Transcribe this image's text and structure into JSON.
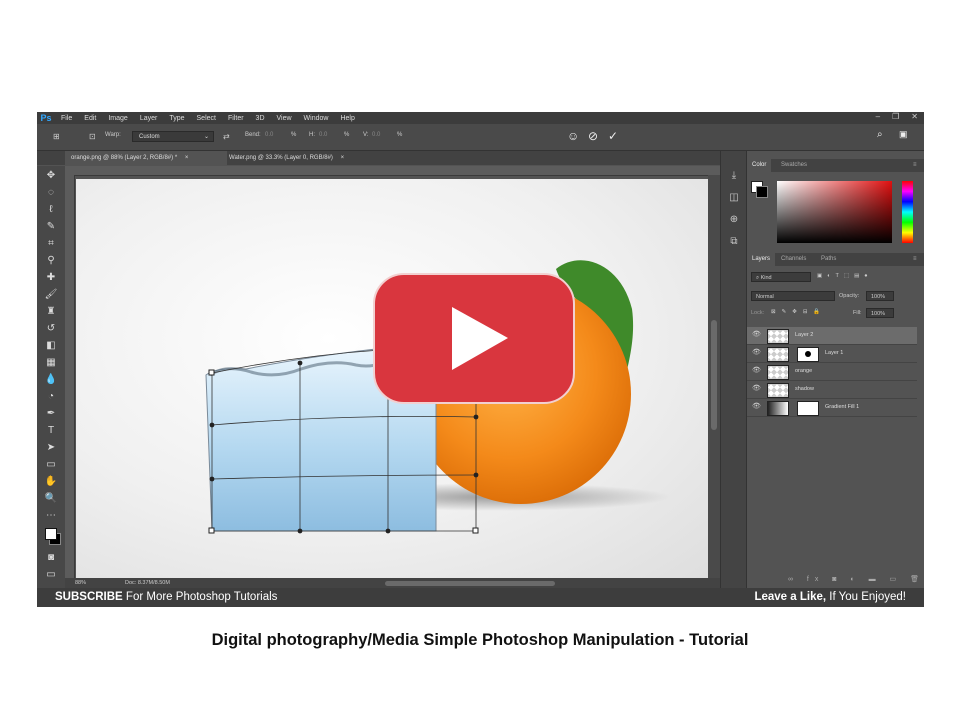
{
  "menu": [
    "File",
    "Edit",
    "Image",
    "Layer",
    "Type",
    "Select",
    "Filter",
    "3D",
    "View",
    "Window",
    "Help"
  ],
  "app_logo": "Ps",
  "options": {
    "warp_label": "Warp:",
    "warp_value": "Custom",
    "bend_label": "Bend:",
    "bend_value": "0.0",
    "bend_unit": "%",
    "h_label": "H:",
    "h_value": "0.0",
    "h_unit": "%",
    "v_label": "V:",
    "v_value": "0.0",
    "v_unit": "%"
  },
  "tabs": [
    {
      "label": "orange.png @ 88% (Layer 2, RGB/8#) *"
    },
    {
      "label": "Water.png @ 33.3% (Layer 0, RGB/8#)"
    }
  ],
  "tab_close": "×",
  "status": {
    "zoom": "88%",
    "doc": "Doc: 8.37M/8.50M"
  },
  "panels": {
    "color_tab": "Color",
    "swatches_tab": "Swatches",
    "layers_tab": "Layers",
    "channels_tab": "Channels",
    "paths_tab": "Paths",
    "kind_placeholder": "Kind",
    "blend_mode": "Normal",
    "opacity_label": "Opacity:",
    "opacity_value": "100%",
    "lock_label": "Lock:",
    "fill_label": "Fill:",
    "fill_value": "100%"
  },
  "layers": [
    {
      "name": "Layer 2",
      "selected": true
    },
    {
      "name": "Layer 1",
      "selected": false
    },
    {
      "name": "orange",
      "selected": false
    },
    {
      "name": "shadow",
      "selected": false
    },
    {
      "name": "Gradient Fill 1",
      "selected": false
    }
  ],
  "banner": {
    "subscribe": "SUBSCRIBE",
    "subscribe_rest": " For More Photoshop Tutorials",
    "like": "Leave a Like,",
    "like_rest": " If You Enjoyed!"
  },
  "caption": "Digital photography/Media Simple Photoshop Manipulation - Tutorial",
  "colors": {
    "play_red": "#d9363e",
    "orange": "#f48a1a",
    "water": "#a9d0ec"
  }
}
